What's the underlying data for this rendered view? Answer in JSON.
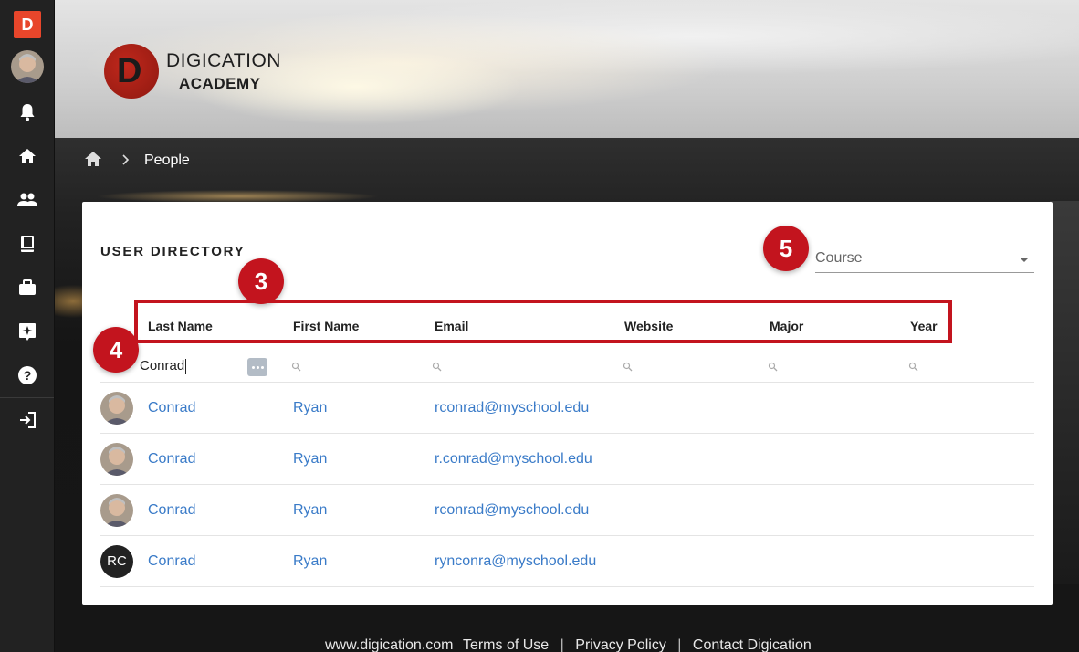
{
  "sidebar": {
    "logo_letter": "D",
    "items": [
      "bell-icon",
      "home-icon",
      "people-icon",
      "book-icon",
      "briefcase-icon",
      "sparkle-icon",
      "help-icon",
      "logout-icon"
    ]
  },
  "brand": {
    "line1": "DIGICATION",
    "line2": "ACADEMY",
    "mark_letter": "D"
  },
  "breadcrumb": {
    "current": "People"
  },
  "directory": {
    "title": "USER DIRECTORY",
    "course_placeholder": "Course",
    "columns": [
      "Last Name",
      "First Name",
      "Email",
      "Website",
      "Major",
      "Year"
    ],
    "filter_value": "Conrad",
    "rows": [
      {
        "last": "Conrad",
        "first": "Ryan",
        "email": "rconrad@myschool.edu",
        "avatar": "photo"
      },
      {
        "last": "Conrad",
        "first": "Ryan",
        "email": "r.conrad@myschool.edu",
        "avatar": "photo"
      },
      {
        "last": "Conrad",
        "first": "Ryan",
        "email": "rconrad@myschool.edu",
        "avatar": "photo"
      },
      {
        "last": "Conrad",
        "first": "Ryan",
        "email": "rynconra@myschool.edu",
        "avatar": "RC"
      }
    ]
  },
  "callouts": {
    "three": "3",
    "four": "4",
    "five": "5"
  },
  "footer": {
    "site": "www.digication.com",
    "terms": "Terms of Use",
    "privacy": "Privacy Policy",
    "contact": "Contact Digication",
    "separator": "|"
  },
  "colors": {
    "accent_red": "#c3141e",
    "link_blue": "#3a7bc8",
    "sidebar_bg": "#222222"
  }
}
